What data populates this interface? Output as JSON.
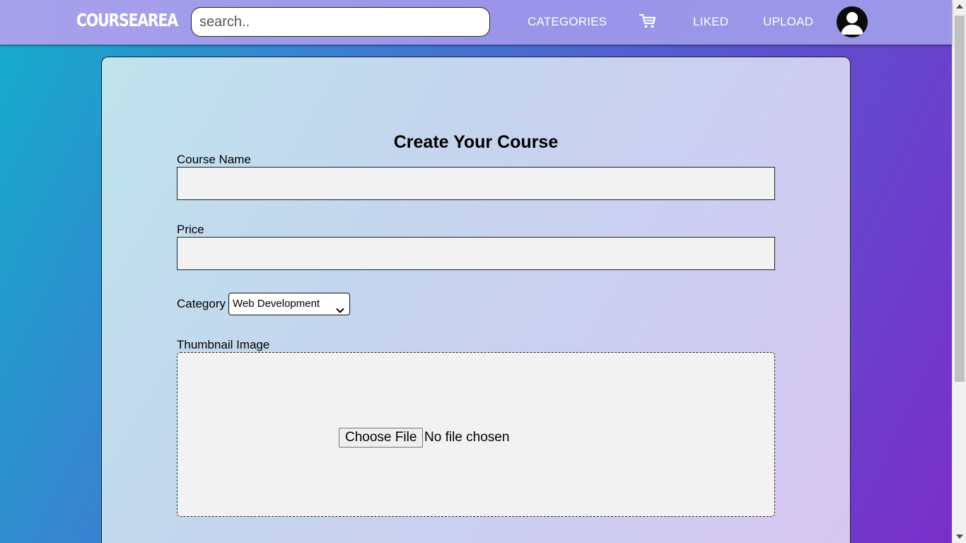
{
  "navbar": {
    "logo": "COURSEAREA",
    "search_placeholder": "search..",
    "links": {
      "categories": "CATEGORIES",
      "liked": "LIKED",
      "upload": "UPLOAD"
    },
    "icons": {
      "cart": "cart-icon",
      "avatar": "user-avatar-icon"
    }
  },
  "form": {
    "title": "Create Your Course",
    "course_name_label": "Course Name",
    "course_name_value": "",
    "price_label": "Price",
    "price_value": "",
    "category_label": "Category",
    "category_selected": "Web Development",
    "thumbnail_label": "Thumbnail Image",
    "file_button_label": "Choose File",
    "file_status": "No file chosen"
  },
  "colors": {
    "navbar": "#9b96e8",
    "background_start": "#13aecb",
    "background_end": "#7a2dc9",
    "field_bg": "#f2f2f2"
  }
}
